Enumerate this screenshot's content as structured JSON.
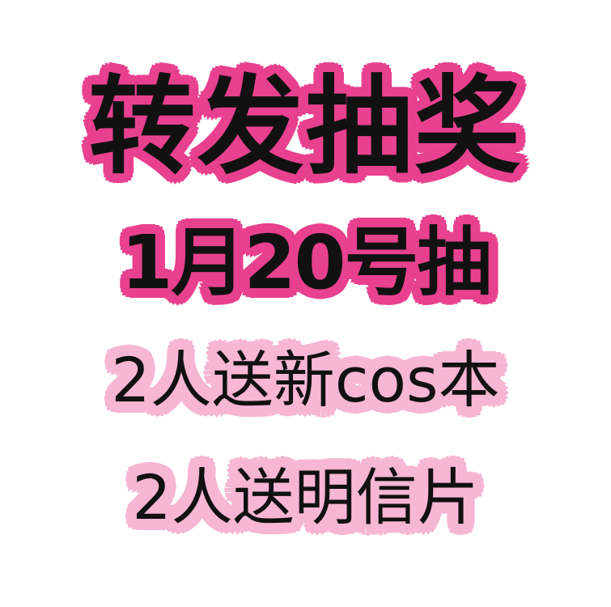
{
  "poster": {
    "headline": "转发抽奖",
    "date_line": "1月20号抽",
    "prize_line_1": "2人送新cos本",
    "prize_line_2": "2人送明信片"
  },
  "colors": {
    "background": "#ffffff",
    "text": "#111111",
    "outline_strong": "#e8418f",
    "outline_light": "#f6b6d4"
  }
}
